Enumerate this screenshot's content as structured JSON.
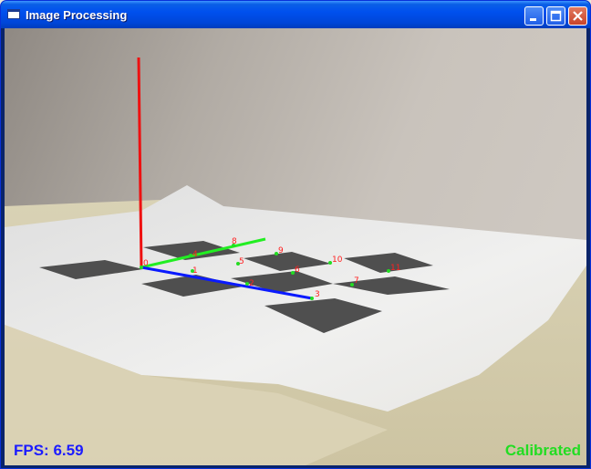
{
  "window": {
    "title": "Image Processing",
    "icon": "window-icon",
    "buttons": [
      "minimize-icon",
      "maximize-icon",
      "close-icon"
    ]
  },
  "overlay": {
    "fps_label": "FPS:",
    "fps_value": "6.59",
    "status": "Calibrated"
  },
  "markers": [
    {
      "label": "0"
    },
    {
      "label": "1"
    },
    {
      "label": "2"
    },
    {
      "label": "3"
    },
    {
      "label": "4"
    },
    {
      "label": "5"
    },
    {
      "label": "6"
    },
    {
      "label": "7"
    },
    {
      "label": "8"
    },
    {
      "label": "9"
    },
    {
      "label": "10"
    },
    {
      "label": "11"
    }
  ],
  "colors": {
    "x_axis": "#0a1aff",
    "y_axis": "#22ee22",
    "z_axis": "#ee1111",
    "fps_text": "#1c1cff",
    "status_text": "#22dd22",
    "marker_label": "#ff2020",
    "marker_dot": "#22dd22"
  }
}
